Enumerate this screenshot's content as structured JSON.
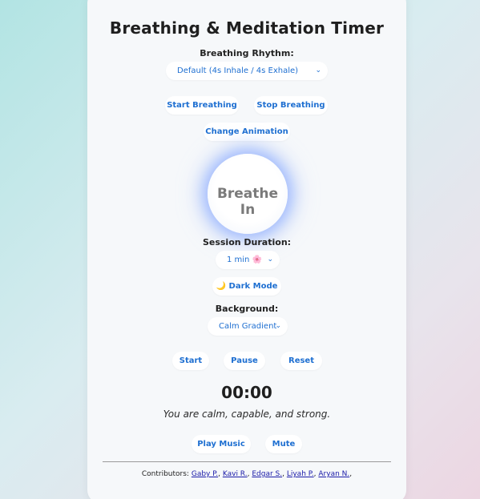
{
  "title": "Breathing & Meditation Timer",
  "rhythm": {
    "label": "Breathing Rhythm:",
    "selected": "Default (4s Inhale / 4s Exhale)"
  },
  "buttons": {
    "start_breathing": "Start Breathing",
    "stop_breathing": "Stop Breathing",
    "change_animation": "Change Animation",
    "dark_mode": "🌙 Dark Mode",
    "start": "Start",
    "pause": "Pause",
    "reset": "Reset",
    "play_music": "Play Music",
    "mute": "Mute"
  },
  "breath_circle": {
    "text": "Breathe In"
  },
  "session": {
    "label": "Session Duration:",
    "selected": "1 min 🌸"
  },
  "background": {
    "label": "Background:",
    "selected": "Calm Gradient"
  },
  "timer": "00:00",
  "affirmation": "You are calm, capable, and strong.",
  "contributors": {
    "label": "Contributors:",
    "names": [
      "Gaby P.",
      "Kavi R.",
      "Edgar S.",
      "Liyah P.",
      "Aryan N."
    ]
  },
  "colors": {
    "accent": "#1e6fd1",
    "glow": "#6e96ff"
  },
  "icons": {
    "select_chevron": "chevron-down-icon",
    "dark_mode": "moon-icon"
  }
}
